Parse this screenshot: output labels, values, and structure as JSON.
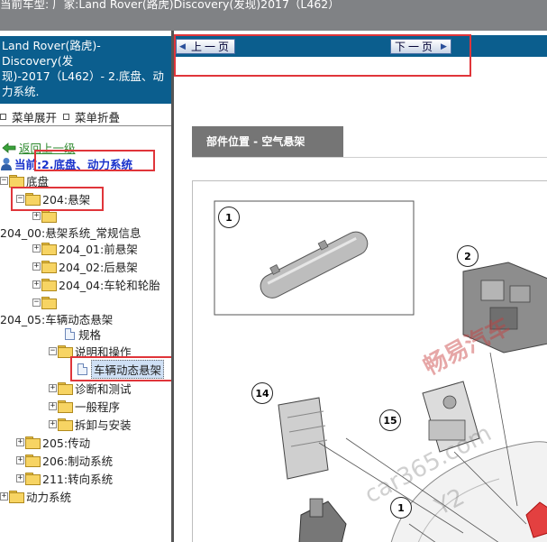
{
  "topbar": {
    "text": "当前车型:  厂家:Land Rover(路虎)Discovery(发现)2017（L462）"
  },
  "left": {
    "vehicle_line1": "Land Rover(路虎)-",
    "vehicle_line2": "Discovery(发",
    "vehicle_line3": "现)-2017（L462）- 2.底盘、动",
    "vehicle_line4": "力系统.",
    "expand_label": "菜单展开",
    "collapse_label": "菜单折叠",
    "back_label": "返回上一级",
    "current_prefix": "当前:",
    "current_value": "2.底盘、动力系统",
    "tree": {
      "chassis": "底盘",
      "suspension": "204:悬架",
      "s204_00": "204_00:悬架系统_常规信息",
      "s204_01": "204_01:前悬架",
      "s204_02": "204_02:后悬架",
      "s204_04": "204_04:车轮和轮胎",
      "s204_05": "204_05:车辆动态悬架",
      "specs": "规格",
      "desc_ops": "说明和操作",
      "vehicle_dynamic": "车辆动态悬架",
      "diag_test": "诊断和测试",
      "general_proc": "一般程序",
      "remove_install": "拆卸与安装",
      "s205": "205:传动",
      "s206": "206:制动系统",
      "s211": "211:转向系统",
      "powertrain": "动力系统"
    }
  },
  "right": {
    "prev_label": "上一页",
    "next_label": "下一页",
    "section_title": "部件位置 - 空气悬架",
    "callouts": [
      "1",
      "2",
      "14",
      "15",
      "1"
    ],
    "watermark_main": "畅易汽车",
    "watermark_site": "car365.com",
    "watermark_site2": "Y2"
  },
  "colors": {
    "header_blue": "#0b5e8e",
    "topbar_gray": "#808285",
    "highlight_red": "#e0353a",
    "section_gray": "#757575"
  }
}
